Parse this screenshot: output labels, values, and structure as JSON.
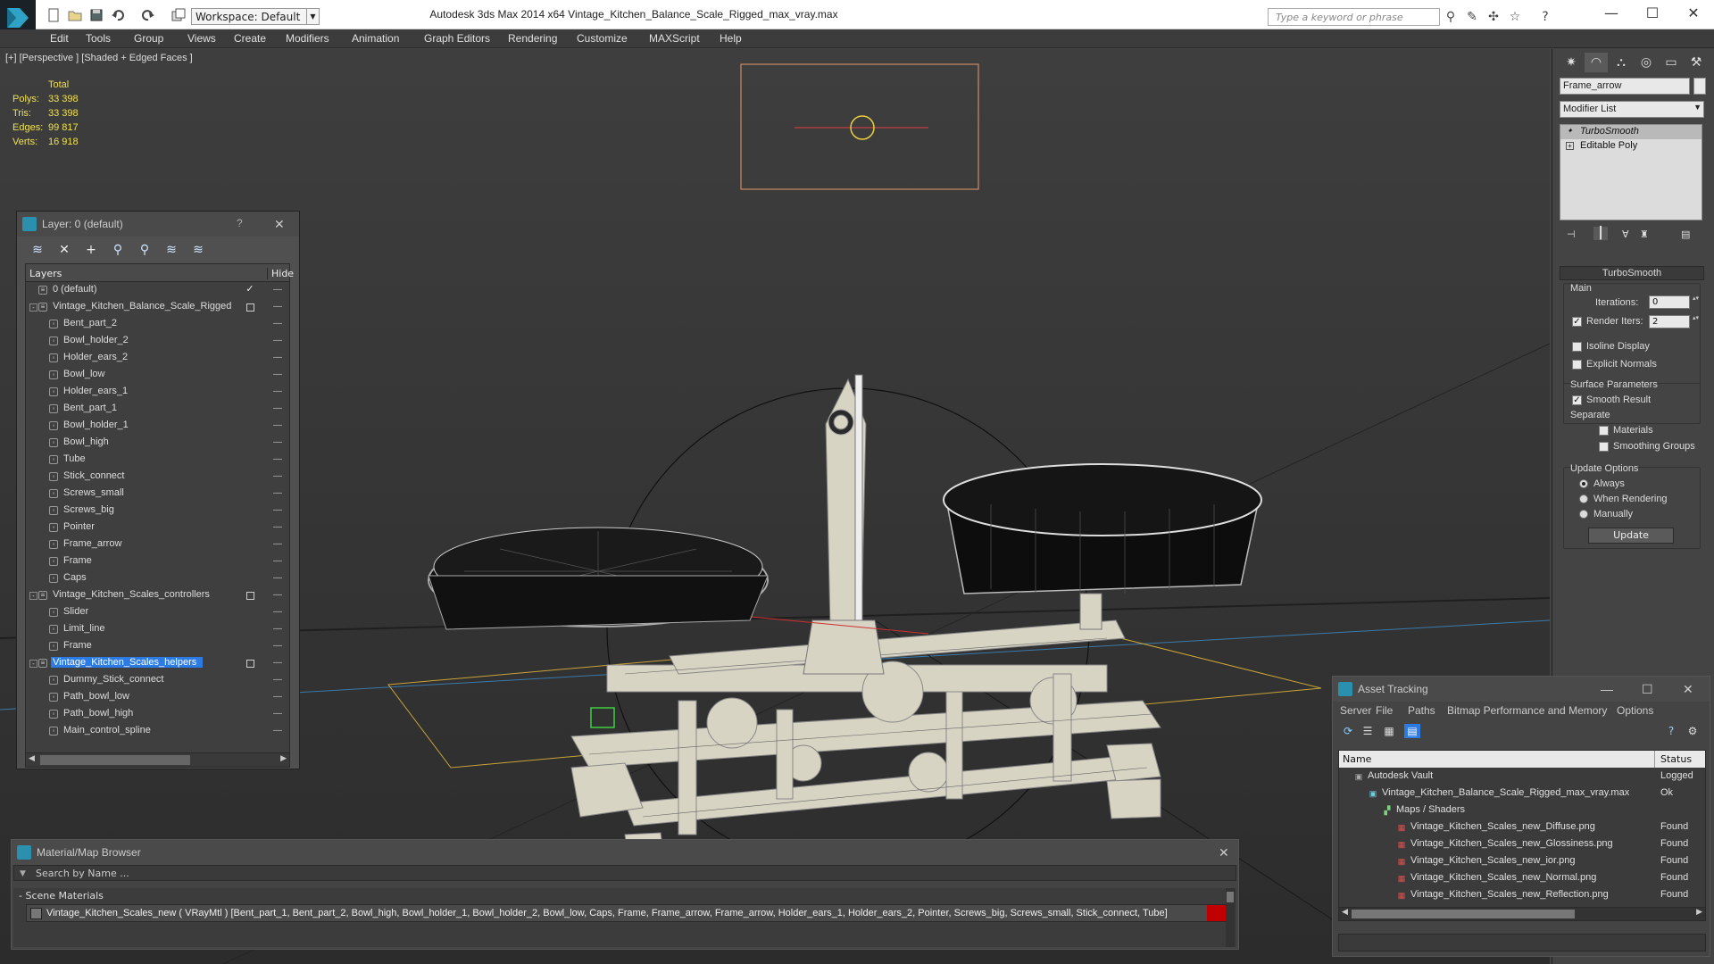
{
  "titlebar": {
    "workspace": "Workspace: Default",
    "app_title": "Autodesk 3ds Max  2014 x64      Vintage_Kitchen_Balance_Scale_Rigged_max_vray.max",
    "search_placeholder": "Type a keyword or phrase"
  },
  "menu": [
    "Edit",
    "Tools",
    "Group",
    "Views",
    "Create",
    "Modifiers",
    "Animation",
    "Graph Editors",
    "Rendering",
    "Customize",
    "MAXScript",
    "Help"
  ],
  "viewport": {
    "label": "[+] [Perspective ] [Shaded + Edged Faces ]",
    "stats": {
      "header": "Total",
      "rows": [
        {
          "k": "Polys:",
          "v": "33 398"
        },
        {
          "k": "Tris:",
          "v": "33 398"
        },
        {
          "k": "Edges:",
          "v": "99 817"
        },
        {
          "k": "Verts:",
          "v": "16 918"
        }
      ]
    }
  },
  "layer_panel": {
    "title": "Layer: 0 (default)",
    "help": "?",
    "col_layers": "Layers",
    "col_hide": "Hide",
    "rows": [
      {
        "name": "0 (default)",
        "level": 0,
        "type": "layer",
        "mark": "check"
      },
      {
        "name": "Vintage_Kitchen_Balance_Scale_Rigged",
        "level": 0,
        "type": "layer",
        "mark": "box",
        "expander": "-"
      },
      {
        "name": "Bent_part_2",
        "level": 1,
        "type": "object"
      },
      {
        "name": "Bowl_holder_2",
        "level": 1,
        "type": "object"
      },
      {
        "name": "Holder_ears_2",
        "level": 1,
        "type": "object"
      },
      {
        "name": "Bowl_low",
        "level": 1,
        "type": "object"
      },
      {
        "name": "Holder_ears_1",
        "level": 1,
        "type": "object"
      },
      {
        "name": "Bent_part_1",
        "level": 1,
        "type": "object"
      },
      {
        "name": "Bowl_holder_1",
        "level": 1,
        "type": "object"
      },
      {
        "name": "Bowl_high",
        "level": 1,
        "type": "object"
      },
      {
        "name": "Tube",
        "level": 1,
        "type": "object"
      },
      {
        "name": "Stick_connect",
        "level": 1,
        "type": "object"
      },
      {
        "name": "Screws_small",
        "level": 1,
        "type": "object"
      },
      {
        "name": "Screws_big",
        "level": 1,
        "type": "object"
      },
      {
        "name": "Pointer",
        "level": 1,
        "type": "object"
      },
      {
        "name": "Frame_arrow",
        "level": 1,
        "type": "object"
      },
      {
        "name": "Frame",
        "level": 1,
        "type": "object"
      },
      {
        "name": "Caps",
        "level": 1,
        "type": "object"
      },
      {
        "name": "Vintage_Kitchen_Scales_controllers",
        "level": 0,
        "type": "layer",
        "mark": "box",
        "expander": "-"
      },
      {
        "name": "Slider",
        "level": 1,
        "type": "object"
      },
      {
        "name": "Limit_line",
        "level": 1,
        "type": "object"
      },
      {
        "name": "Frame",
        "level": 1,
        "type": "object"
      },
      {
        "name": "Vintage_Kitchen_Scales_helpers",
        "level": 0,
        "type": "layer",
        "mark": "box",
        "expander": "-",
        "selected": true
      },
      {
        "name": "Dummy_Stick_connect",
        "level": 1,
        "type": "object"
      },
      {
        "name": "Path_bowl_low",
        "level": 1,
        "type": "object"
      },
      {
        "name": "Path_bowl_high",
        "level": 1,
        "type": "object"
      },
      {
        "name": "Main_control_spline",
        "level": 1,
        "type": "object"
      }
    ]
  },
  "command_panel": {
    "object_name": "Frame_arrow",
    "modifier_list": "Modifier List",
    "stack": [
      "TurboSmooth",
      "Editable Poly"
    ],
    "rollout_title": "TurboSmooth",
    "main_label": "Main",
    "iterations_label": "Iterations:",
    "iterations_value": "0",
    "render_iters_label": "Render Iters:",
    "render_iters_value": "2",
    "isoline_label": "Isoline Display",
    "explicit_label": "Explicit Normals",
    "surface_label": "Surface Parameters",
    "smooth_label": "Smooth Result",
    "separate_label": "Separate",
    "materials_label": "Materials",
    "smoothing_groups_label": "Smoothing Groups",
    "update_options_label": "Update Options",
    "always_label": "Always",
    "when_rendering_label": "When Rendering",
    "manually_label": "Manually",
    "update_button": "Update"
  },
  "asset_tracking": {
    "title": "Asset Tracking",
    "menu": [
      "Server",
      "File",
      "Paths",
      "Bitmap Performance and Memory",
      "Options"
    ],
    "col_name": "Name",
    "col_status": "Status",
    "rows": [
      {
        "name": "Autodesk Vault",
        "status": "Logged",
        "indent": 1,
        "icon": "vault"
      },
      {
        "name": "Vintage_Kitchen_Balance_Scale_Rigged_max_vray.max",
        "status": "Ok",
        "indent": 2,
        "icon": "max"
      },
      {
        "name": "Maps / Shaders",
        "status": "",
        "indent": 3,
        "icon": "maps"
      },
      {
        "name": "Vintage_Kitchen_Scales_new_Diffuse.png",
        "status": "Found",
        "indent": 4,
        "icon": "png"
      },
      {
        "name": "Vintage_Kitchen_Scales_new_Glossiness.png",
        "status": "Found",
        "indent": 4,
        "icon": "png"
      },
      {
        "name": "Vintage_Kitchen_Scales_new_ior.png",
        "status": "Found",
        "indent": 4,
        "icon": "png"
      },
      {
        "name": "Vintage_Kitchen_Scales_new_Normal.png",
        "status": "Found",
        "indent": 4,
        "icon": "png"
      },
      {
        "name": "Vintage_Kitchen_Scales_new_Reflection.png",
        "status": "Found",
        "indent": 4,
        "icon": "png"
      }
    ]
  },
  "material_browser": {
    "title": "Material/Map Browser",
    "search_placeholder": "Search by Name ...",
    "section": "- Scene Materials",
    "material_row": "Vintage_Kitchen_Scales_new  ( VRayMtl ) [Bent_part_1, Bent_part_2, Bowl_high, Bowl_holder_1, Bowl_holder_2, Bowl_low, Caps, Frame, Frame_arrow, Frame_arrow, Holder_ears_1, Holder_ears_2, Pointer, Screws_big, Screws_small, Stick_connect, Tube]"
  },
  "colors": {
    "accent_blue": "#2c7be5",
    "stats_yellow": "#f0e050",
    "viewport_bg": "#333333",
    "wire_orange": "#e89a6a",
    "missing_red": "#c00000"
  }
}
